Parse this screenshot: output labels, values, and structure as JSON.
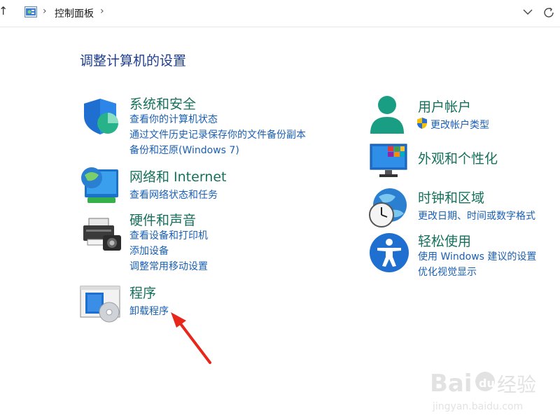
{
  "address_bar": {
    "up_arrow": "↑",
    "separator": "›",
    "breadcrumb": "控制面板",
    "icons": [
      "control-panel-icon",
      "chevron-down-icon",
      "refresh-icon"
    ]
  },
  "page_title": "调整计算机的设置",
  "categories": {
    "system_security": {
      "title": "系统和安全",
      "links": [
        "查看你的计算机状态",
        "通过文件历史记录保存你的文件备份副本",
        "备份和还原(Windows 7)"
      ]
    },
    "network": {
      "title": "网络和 Internet",
      "links": [
        "查看网络状态和任务"
      ]
    },
    "hardware": {
      "title": "硬件和声音",
      "links": [
        "查看设备和打印机",
        "添加设备",
        "调整常用移动设置"
      ]
    },
    "programs": {
      "title": "程序",
      "links": [
        "卸载程序"
      ]
    },
    "user_accounts": {
      "title": "用户帐户",
      "links": [
        "更改帐户类型"
      ]
    },
    "appearance": {
      "title": "外观和个性化",
      "links": []
    },
    "clock_region": {
      "title": "时钟和区域",
      "links": [
        "更改日期、时间或数字格式"
      ]
    },
    "ease_access": {
      "title": "轻松使用",
      "links": [
        "使用 Windows 建议的设置",
        "优化视觉显示"
      ]
    }
  },
  "colors": {
    "title_blue": "#1e3d8f",
    "category_green": "#16705b",
    "link_blue": "#1a5fb4",
    "annotation_red": "#e8261c"
  },
  "watermark": {
    "brand_a": "Bai",
    "brand_b": "du",
    "brand_c": "经验",
    "url": "jingyan.baidu.com"
  }
}
